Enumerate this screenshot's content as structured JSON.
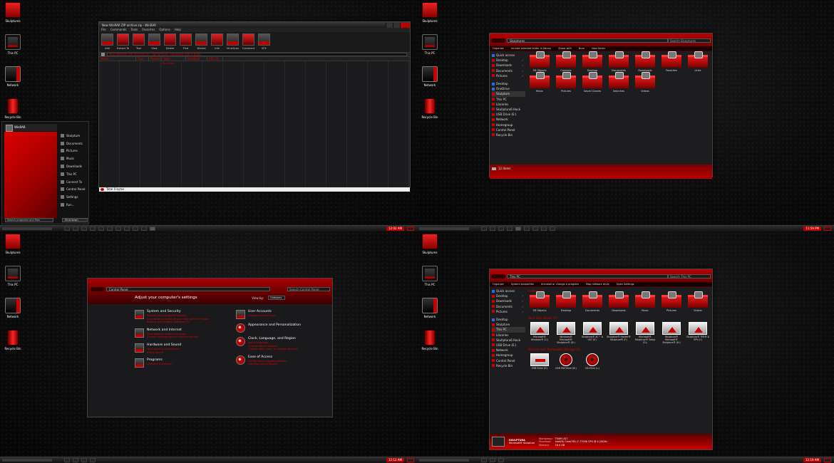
{
  "desktop": {
    "icons": [
      "Skulptures",
      "This PC",
      "Network",
      "Recycle Bin"
    ]
  },
  "taskbars": {
    "q1_time": "12:02 AM",
    "q2_time": "11:59 PM",
    "q3_time": "12:12 AM",
    "q4_time": "12:19 AM"
  },
  "zip": {
    "title": "New WinRAR ZIP archive.zip - WinRAR",
    "menu": [
      "File",
      "Commands",
      "Tools",
      "Favorites",
      "Options",
      "Help"
    ],
    "tools": [
      "Add",
      "Extract To",
      "Test",
      "View",
      "Delete",
      "Find",
      "Wizard",
      "Info",
      "VirusScan",
      "Comment",
      "SFX"
    ],
    "address": "New WinRAR ZIP archive.zip - ZIP archive, unpacked size 0 bytes",
    "columns": [
      "Name",
      "Size",
      "Packed",
      "Type",
      "Modified",
      "CRC32"
    ],
    "row_type": "File folder",
    "status": "Total 0 bytes"
  },
  "startmenu": {
    "user": "WinRAR",
    "items": [
      "Skulpture",
      "Documents",
      "Pictures",
      "Music",
      "Downloads",
      "This PC",
      "Connect To",
      "Control Panel",
      "Settings",
      "Run..."
    ],
    "search": "Search programs and files",
    "shutdown": "Shut down"
  },
  "explorer1": {
    "address": "Skulptures",
    "search": "Search Skulptures",
    "commands": [
      "Organize",
      "Include selected folder in library",
      "Share with",
      "Burn",
      "New folder"
    ],
    "nav": [
      {
        "label": "Quick access",
        "kind": "b",
        "check": ""
      },
      {
        "label": "Desktop",
        "kind": "r",
        "check": "✓"
      },
      {
        "label": "Downloads",
        "kind": "r",
        "check": "✓"
      },
      {
        "label": "Documents",
        "kind": "r",
        "check": "✓"
      },
      {
        "label": "Pictures",
        "kind": "r",
        "check": "✓"
      },
      {
        "label": "",
        "kind": "s",
        "check": ""
      },
      {
        "label": "Desktop",
        "kind": "b",
        "check": ""
      },
      {
        "label": "OneDrive",
        "kind": "b",
        "check": ""
      },
      {
        "label": "Skulpture",
        "kind": "h",
        "check": ""
      },
      {
        "label": "This PC",
        "kind": "r",
        "check": ""
      },
      {
        "label": "Libraries",
        "kind": "r",
        "check": ""
      },
      {
        "label": "Skullptura6 Hack",
        "kind": "r",
        "check": ""
      },
      {
        "label": "USB Drive (E:)",
        "kind": "r",
        "check": ""
      },
      {
        "label": "Network",
        "kind": "r",
        "check": ""
      },
      {
        "label": "Homegroup",
        "kind": "r",
        "check": ""
      },
      {
        "label": "Control Panel",
        "kind": "r",
        "check": ""
      },
      {
        "label": "Recycle Bin",
        "kind": "r",
        "check": ""
      }
    ],
    "folders": [
      "3D Objects",
      "Contacts",
      "Desktop",
      "Documents",
      "Downloads",
      "Favorites",
      "Links",
      "Music",
      "Pictures",
      "Saved Games",
      "Searches",
      "Videos"
    ],
    "status": "12 items"
  },
  "controlpanel": {
    "address": "Control Panel",
    "search": "Search Control Panel",
    "heading": "Adjust your computer's settings",
    "view_label": "View by:",
    "view_value": "Category",
    "left": [
      {
        "title": "System and Security",
        "links": [
          "Review your computer's status",
          "Save backup copies of your files with File History",
          "Backup and Restore (Windows 7)"
        ],
        "round": false
      },
      {
        "title": "Network and Internet",
        "links": [
          "View network status and tasks",
          "Choose homegroup and sharing options"
        ],
        "round": false
      },
      {
        "title": "Hardware and Sound",
        "links": [
          "View devices and printers",
          "Add a device"
        ],
        "round": false
      },
      {
        "title": "Programs",
        "links": [
          "Uninstall a program"
        ],
        "round": false
      }
    ],
    "right": [
      {
        "title": "User Accounts",
        "links": [
          "Change account type"
        ],
        "round": false
      },
      {
        "title": "Appearance and Personalization",
        "links": [],
        "round": true
      },
      {
        "title": "Clock, Language, and Region",
        "links": [
          "Add a language",
          "Change input methods",
          "Change date, time, or number formats"
        ],
        "round": true
      },
      {
        "title": "Ease of Access",
        "links": [
          "Let Windows suggest settings",
          "Optimize visual display"
        ],
        "round": true
      }
    ]
  },
  "explorer2": {
    "address": "This PC",
    "search": "Search This PC",
    "commands": [
      "Organize",
      "System properties",
      "Uninstall or change a program",
      "Map network drive",
      "Open Settings"
    ],
    "nav": [
      {
        "label": "Quick access",
        "kind": "b",
        "check": ""
      },
      {
        "label": "Desktop",
        "kind": "r",
        "check": "✓"
      },
      {
        "label": "Downloads",
        "kind": "r",
        "check": "✓"
      },
      {
        "label": "Documents",
        "kind": "r",
        "check": "✓"
      },
      {
        "label": "Pictures",
        "kind": "r",
        "check": "✓"
      },
      {
        "label": "",
        "kind": "s",
        "check": ""
      },
      {
        "label": "Desktop",
        "kind": "b",
        "check": ""
      },
      {
        "label": "Skulpture",
        "kind": "r",
        "check": ""
      },
      {
        "label": "This PC",
        "kind": "h",
        "check": ""
      },
      {
        "label": "Libraries",
        "kind": "r",
        "check": ""
      },
      {
        "label": "Skullptura6 Hack",
        "kind": "r",
        "check": ""
      },
      {
        "label": "USB Drive (E:)",
        "kind": "r",
        "check": ""
      },
      {
        "label": "Network",
        "kind": "r",
        "check": ""
      },
      {
        "label": "Homegroup",
        "kind": "r",
        "check": ""
      },
      {
        "label": "Control Panel",
        "kind": "r",
        "check": ""
      },
      {
        "label": "Recycle Bin",
        "kind": "r",
        "check": ""
      }
    ],
    "sec_folders": "Folders (7)",
    "folders": [
      "3D Objects",
      "Desktop",
      "Documents",
      "Downloads",
      "Music",
      "Pictures",
      "Videos"
    ],
    "sec_drives": "Hard Disk Drives (7)",
    "drives": [
      "Microsoft® Windows® (C:)",
      "Windows® Microsoft® Skulpture® (D:)",
      "Skulptura® XC™ & US7 (E:)",
      "Skulptura® Hacker® Skulpture® (F:)",
      "Microsoft® Skulpture® Setup (G:)",
      "Skulptura® Microsoft® Skulpture® (H:)",
      "Skulptura® TER® & SPV (I:)"
    ],
    "sec_removable": "Devices with Removable Storage (3)",
    "removable": [
      "USB Drive (E:)",
      "DVD RW Drive (B:)",
      "CD Drive (L:)"
    ],
    "details": {
      "name": "SKULPTURA",
      "sub": "Microsoft® Skulpture",
      "workgroup_label": "Workgroup:",
      "workgroup": "TEAM LIST",
      "processor_label": "Processor:",
      "processor": "Intel(R) Core(TM) i7-7700K CPU @ 4.20GHz",
      "memory_label": "Memory:",
      "memory": "16.0 GB"
    }
  }
}
